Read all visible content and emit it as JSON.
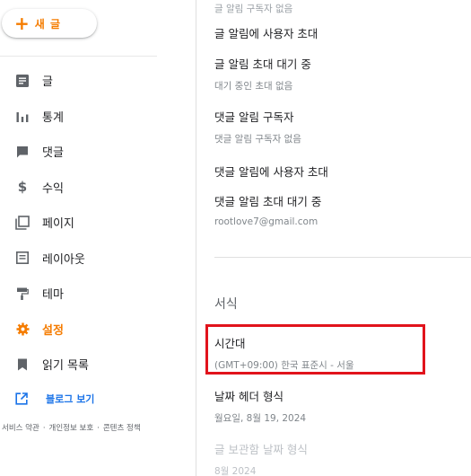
{
  "new_post": {
    "plus": "+",
    "label": "새 글"
  },
  "nav": [
    {
      "label": "글",
      "icon": "posts-icon"
    },
    {
      "label": "통계",
      "icon": "stats-icon"
    },
    {
      "label": "댓글",
      "icon": "comment-icon"
    },
    {
      "label": "수익",
      "icon": "dollar-icon"
    },
    {
      "label": "페이지",
      "icon": "pages-icon"
    },
    {
      "label": "레이아웃",
      "icon": "layout-icon"
    },
    {
      "label": "테마",
      "icon": "paint-roller-icon"
    },
    {
      "label": "설정",
      "icon": "gear-icon",
      "active": true
    },
    {
      "label": "읽기 목록",
      "icon": "bookmark-icon"
    }
  ],
  "view_blog": "블로그 보기",
  "footer": {
    "terms": "서비스 약관",
    "privacy": "개인정보 보호",
    "content_policy": "콘텐츠 정책",
    "separator": "·"
  },
  "main": {
    "top_partial": "글 알림 구독자 없음",
    "post_invite": "글 알림에 사용자 초대",
    "post_pending": {
      "title": "글 알림 초대 대기 중",
      "sub": "대기 중인 초대 없음"
    },
    "comment_subscribers": {
      "title": "댓글 알림 구독자",
      "sub": "댓글 알림 구독자 없음"
    },
    "comment_invite": "댓글 알림에 사용자 초대",
    "comment_pending": {
      "title": "댓글 알림 초대 대기 중",
      "sub": "rootlove7@gmail.com"
    },
    "format_section": "서식",
    "timezone": {
      "title": "시간대",
      "sub": "(GMT+09:00) 한국 표준시 - 서울"
    },
    "date_header": {
      "title": "날짜 헤더 형식",
      "sub": "월요일, 8월 19, 2024"
    },
    "archive_date": {
      "title": "글 보관함 날짜 형식",
      "sub": "8월 2024"
    }
  },
  "colors": {
    "accent": "#f57c00",
    "link": "#1a73e8",
    "highlight": "#e1131c"
  }
}
